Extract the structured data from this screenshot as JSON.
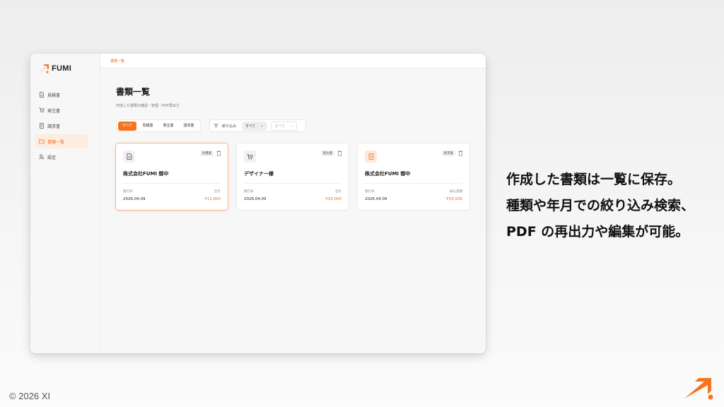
{
  "app": {
    "logo_text": "FUMI",
    "accent_color": "#f5741f"
  },
  "sidebar": {
    "items": [
      {
        "label": "見積書",
        "icon": "file-document-icon",
        "active": false
      },
      {
        "label": "発注書",
        "icon": "cart-icon",
        "active": false
      },
      {
        "label": "請求書",
        "icon": "receipt-icon",
        "active": false
      },
      {
        "label": "書類一覧",
        "icon": "folder-icon",
        "active": true
      },
      {
        "label": "設定",
        "icon": "user-settings-icon",
        "active": false
      }
    ]
  },
  "header": {
    "breadcrumb": "書類一覧"
  },
  "main": {
    "title": "書類一覧",
    "subtitle": "作成した書類の確認・管理・PDF再出力",
    "tabs": [
      {
        "label": "すべて",
        "active": true
      },
      {
        "label": "見積書",
        "active": false
      },
      {
        "label": "発注書",
        "active": false
      },
      {
        "label": "請求書",
        "active": false
      }
    ],
    "filter": {
      "label": "絞り込み",
      "year_value": "すべて",
      "month_value": "すべて"
    },
    "cards": [
      {
        "type_badge": "見積書",
        "icon": "file-document-icon",
        "name": "株式会社FUMI 御中",
        "date_label": "発行日",
        "date": "2026.04.09",
        "amount_label": "合計",
        "amount": "¥11,000"
      },
      {
        "type_badge": "発注書",
        "icon": "cart-icon",
        "name": "デザイナー様",
        "date_label": "発行日",
        "date": "2026.04.09",
        "amount_label": "合計",
        "amount": "¥33,000"
      },
      {
        "type_badge": "請求書",
        "icon": "receipt-icon",
        "name": "株式会社FUMI 御中",
        "date_label": "発行日",
        "date": "2026.04.09",
        "amount_label": "振込金額",
        "amount": "¥33,936"
      }
    ]
  },
  "copy": {
    "lines": [
      "作成した書類は一覧に保存。",
      "種類や年月での絞り込み検索、",
      "PDF の再出力や編集が可能。"
    ]
  },
  "footer": {
    "copyright": "© 2026 XI"
  }
}
